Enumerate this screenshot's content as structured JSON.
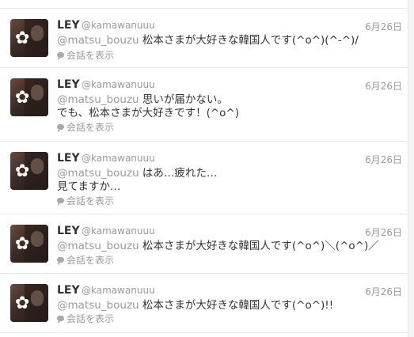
{
  "timeline": {
    "tweets": [
      {
        "name": "LEY",
        "handle": "@kamawanuuu",
        "date": "6月26日",
        "mention": "@matsu_bouzu",
        "line1": " 松本さまが大好きな韓国人です(^o^)(^-^)/",
        "line2": "",
        "conversation_label": "会話を表示"
      },
      {
        "name": "LEY",
        "handle": "@kamawanuuu",
        "date": "6月26日",
        "mention": "@matsu_bouzu",
        "line1": " 思いが届かない。",
        "line2": "でも、松本さまが大好きです！(^o^)",
        "conversation_label": "会話を表示"
      },
      {
        "name": "LEY",
        "handle": "@kamawanuuu",
        "date": "6月26日",
        "mention": "@matsu_bouzu",
        "line1": " はあ…疲れた…",
        "line2": "見てますか…",
        "conversation_label": "会話を表示"
      },
      {
        "name": "LEY",
        "handle": "@kamawanuuu",
        "date": "6月26日",
        "mention": "@matsu_bouzu",
        "line1": " 松本さまが大好きな韓国人です(^o^)＼(^o^)／",
        "line2": "",
        "conversation_label": "会話を表示"
      },
      {
        "name": "LEY",
        "handle": "@kamawanuuu",
        "date": "6月26日",
        "mention": "@matsu_bouzu",
        "line1": " 松本さまが大好きな韓国人です(^o^)!!",
        "line2": "",
        "conversation_label": "会話を表示"
      }
    ]
  }
}
